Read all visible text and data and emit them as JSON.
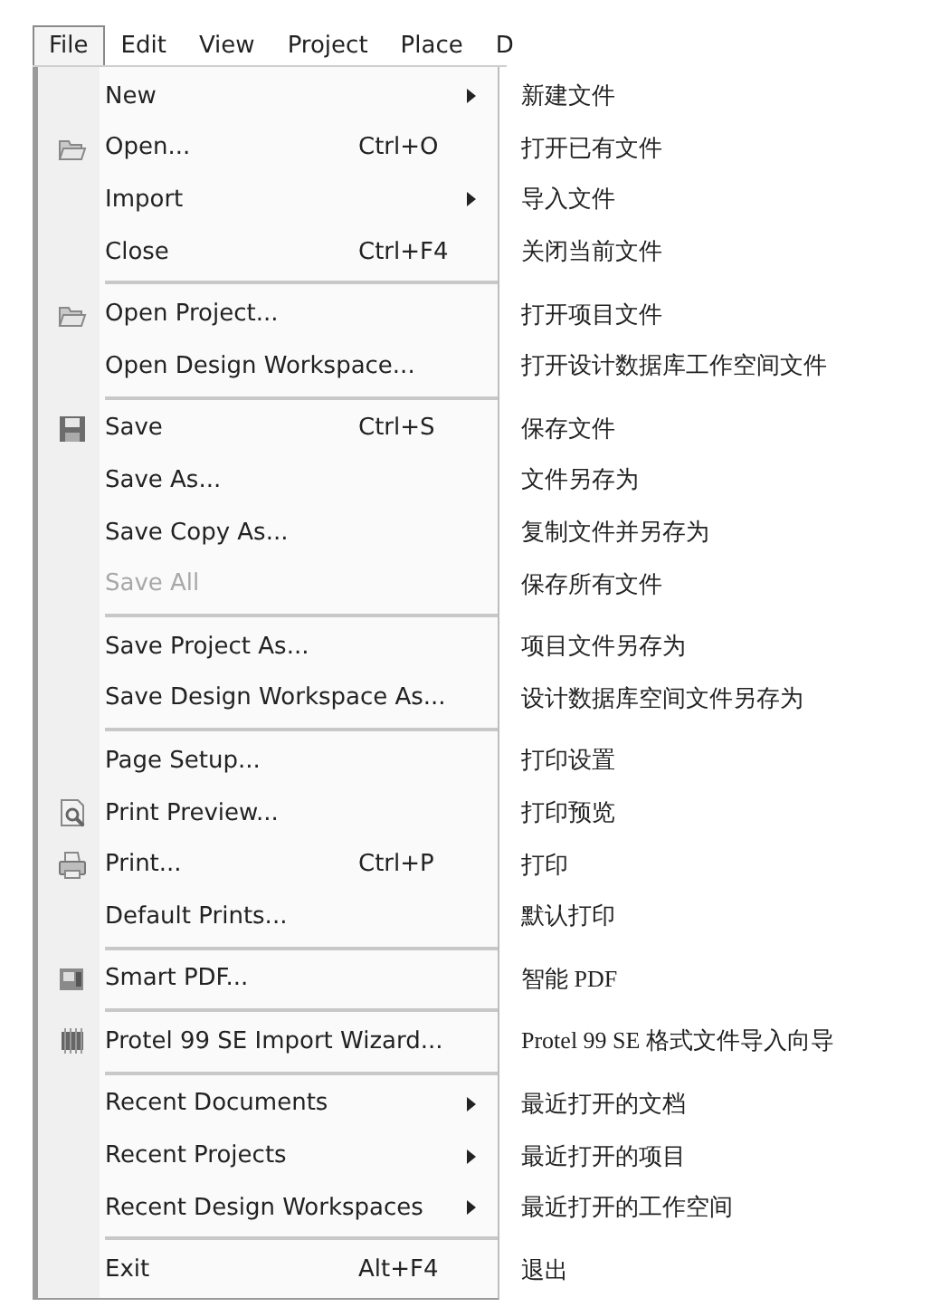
{
  "menu_bar": [
    {
      "label": "File",
      "selected": true
    },
    {
      "label": "Edit",
      "selected": false
    },
    {
      "label": "View",
      "selected": false
    },
    {
      "label": "Project",
      "selected": false
    },
    {
      "label": "Place",
      "selected": false
    },
    {
      "label": "D",
      "selected": false
    }
  ],
  "menu": {
    "groups": [
      {
        "items": [
          {
            "kind": "plain",
            "label": "New",
            "submenu": true,
            "disabled": false,
            "annotation": "新建文件"
          },
          {
            "kind": "open",
            "label": "Open...",
            "shortcut": "Ctrl+O",
            "submenu": false,
            "disabled": false,
            "annotation": "打开已有文件"
          },
          {
            "kind": "plain",
            "label": "Import",
            "submenu": true,
            "disabled": false,
            "annotation": "导入文件"
          },
          {
            "kind": "plain",
            "label": "Close",
            "shortcut": "Ctrl+F4",
            "submenu": false,
            "disabled": false,
            "annotation": "关闭当前文件"
          }
        ]
      },
      {
        "items": [
          {
            "kind": "open",
            "label": "Open Project...",
            "submenu": false,
            "disabled": false,
            "annotation": "打开项目文件"
          },
          {
            "kind": "plain",
            "label": "Open Design Workspace...",
            "submenu": false,
            "disabled": false,
            "annotation": "打开设计数据库工作空间文件"
          }
        ]
      },
      {
        "items": [
          {
            "kind": "save",
            "label": "Save",
            "shortcut": "Ctrl+S",
            "submenu": false,
            "disabled": false,
            "annotation": "保存文件"
          },
          {
            "kind": "plain",
            "label": "Save As...",
            "submenu": false,
            "disabled": false,
            "annotation": "文件另存为"
          },
          {
            "kind": "plain",
            "label": "Save Copy As...",
            "submenu": false,
            "disabled": false,
            "annotation": "复制文件并另存为"
          },
          {
            "kind": "plain",
            "label": "Save All",
            "submenu": false,
            "disabled": true,
            "annotation": "保存所有文件"
          }
        ]
      },
      {
        "items": [
          {
            "kind": "plain",
            "label": "Save Project As...",
            "submenu": false,
            "disabled": false,
            "annotation": "项目文件另存为"
          },
          {
            "kind": "plain",
            "label": "Save Design Workspace As...",
            "submenu": false,
            "disabled": false,
            "annotation": "设计数据库空间文件另存为"
          }
        ]
      },
      {
        "items": [
          {
            "kind": "plain",
            "label": "Page Setup...",
            "submenu": false,
            "disabled": false,
            "annotation": "打印设置"
          },
          {
            "kind": "preview",
            "label": "Print Preview...",
            "submenu": false,
            "disabled": false,
            "annotation": "打印预览"
          },
          {
            "kind": "print",
            "label": "Print...",
            "shortcut": "Ctrl+P",
            "submenu": false,
            "disabled": false,
            "annotation": "打印"
          },
          {
            "kind": "plain",
            "label": "Default Prints...",
            "submenu": false,
            "disabled": false,
            "annotation": "默认打印"
          }
        ]
      },
      {
        "items": [
          {
            "kind": "pdf",
            "label": "Smart PDF...",
            "submenu": false,
            "disabled": false,
            "annotation": "智能 PDF"
          }
        ]
      },
      {
        "items": [
          {
            "kind": "wizard",
            "label": "Protel 99 SE Import Wizard...",
            "submenu": false,
            "disabled": false,
            "annotation": "Protel 99 SE 格式文件导入向导"
          }
        ]
      },
      {
        "items": [
          {
            "kind": "plain",
            "label": "Recent Documents",
            "submenu": true,
            "disabled": false,
            "annotation": "最近打开的文档"
          },
          {
            "kind": "plain",
            "label": "Recent Projects",
            "submenu": true,
            "disabled": false,
            "annotation": "最近打开的项目"
          },
          {
            "kind": "plain",
            "label": "Recent Design Workspaces",
            "submenu": true,
            "disabled": false,
            "annotation": "最近打开的工作空间"
          }
        ]
      },
      {
        "items": [
          {
            "kind": "plain",
            "label": "Exit",
            "shortcut": "Alt+F4",
            "submenu": false,
            "disabled": false,
            "annotation": "退出"
          }
        ]
      }
    ]
  }
}
